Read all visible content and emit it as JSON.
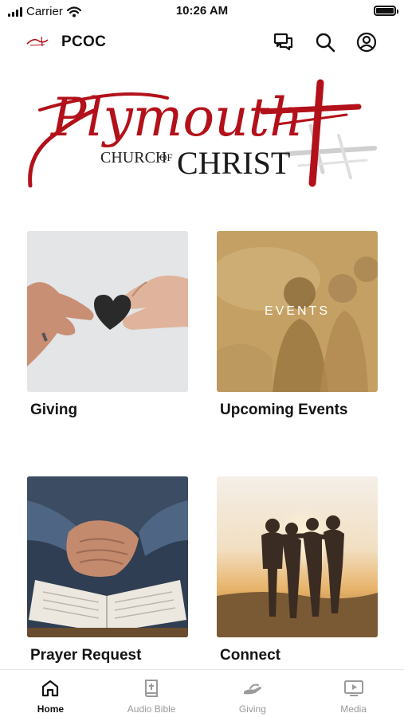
{
  "status_bar": {
    "carrier": "Carrier",
    "time": "10:26 AM"
  },
  "header": {
    "title": "PCOC"
  },
  "banner": {
    "script_text": "Plymouth",
    "church_text": "Church of",
    "church_caps": "CHURCH",
    "of_text": "OF",
    "christ_text": "CHRIST",
    "brand_color": "#b3111a"
  },
  "tiles": [
    {
      "label": "Giving",
      "overlay_text": ""
    },
    {
      "label": "Upcoming Events",
      "overlay_text": "EVENTS"
    },
    {
      "label": "Prayer Request",
      "overlay_text": ""
    },
    {
      "label": "Connect",
      "overlay_text": ""
    }
  ],
  "bottom_nav": [
    {
      "label": "Home",
      "icon": "home-icon",
      "active": true
    },
    {
      "label": "Audio Bible",
      "icon": "bible-icon",
      "active": false
    },
    {
      "label": "Giving",
      "icon": "giving-icon",
      "active": false
    },
    {
      "label": "Media",
      "icon": "media-icon",
      "active": false
    }
  ]
}
